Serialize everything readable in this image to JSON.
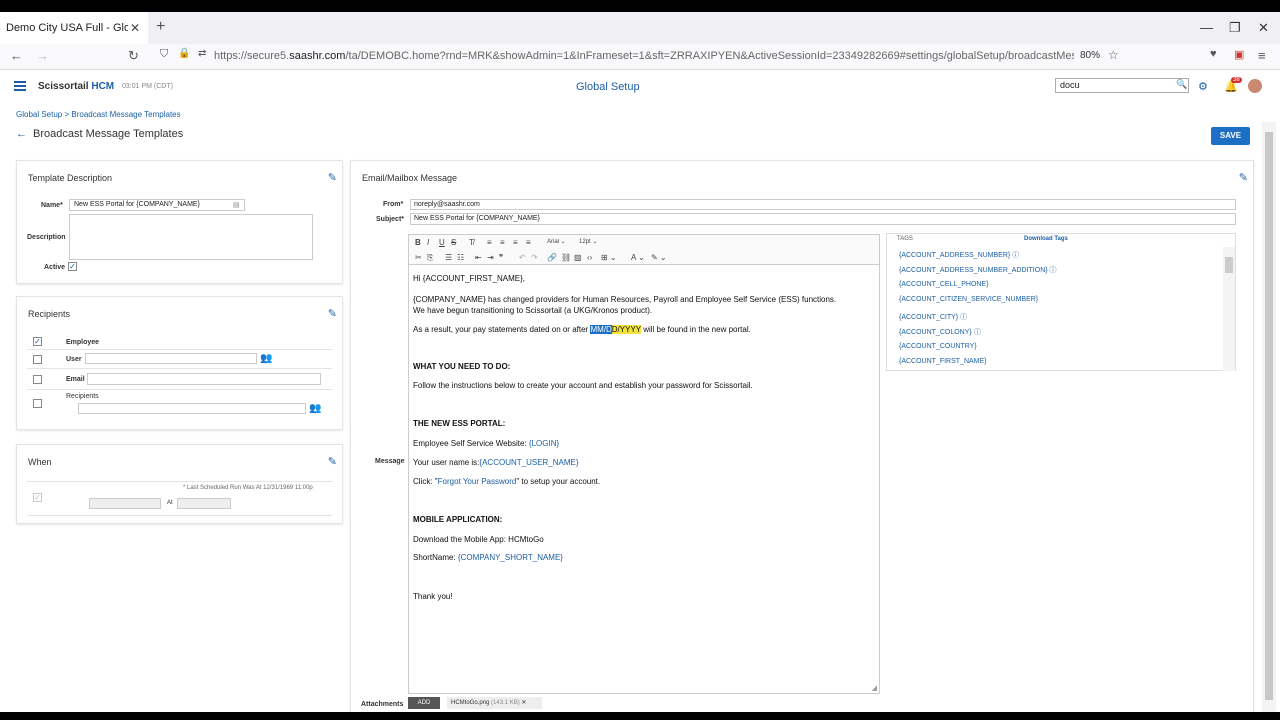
{
  "browser": {
    "tab_title": "Demo City USA Full - Global Setup",
    "tab_close": "✕",
    "new_tab": "+",
    "url_prefix": "https://secure5.",
    "url_domain": "saashr.com",
    "url_rest": "/ta/DEMOBC.home?rnd=MRK&showAdmin=1&InFrameset=1&sft=ZRRAXIPYEN&ActiveSessionId=23349282669#settings/globalSetup/broadcastMessageTemplates?impl=zeyt.progra",
    "zoom": "80%"
  },
  "header": {
    "logo_main": "Scissortail ",
    "logo_hcm": "HCM",
    "clock": "03:01 PM (CDT)",
    "title": "Global Setup",
    "search_value": "docu",
    "notif_count": "38"
  },
  "breadcrumb": "Global Setup > Broadcast Message Templates",
  "page_title": "Broadcast Message Templates",
  "save_label": "SAVE",
  "template": {
    "title": "Template Description",
    "name_label": "Name*",
    "name_value": "New ESS Portal for {COMPANY_NAME}",
    "description_label": "Description",
    "active_label": "Active"
  },
  "recipients": {
    "title": "Recipients",
    "employee": "Employee",
    "user": "User",
    "email": "Email",
    "recipients": "Recipients"
  },
  "when": {
    "title": "When",
    "last_run": "* Last Scheduled Run Was At 12/31/1969 11:00p",
    "at": "At"
  },
  "email": {
    "title": "Email/Mailbox Message",
    "from_label": "From*",
    "from_value": "noreply@saashr.com",
    "subject_label": "Subject*",
    "subject_value": "New ESS Portal for {COMPANY_NAME}",
    "message_label": "Message",
    "attachments_label": "Attachments",
    "add_label": "ADD",
    "attachment_file": "HCMtoGo.png",
    "attachment_size": "(143.1 KB)",
    "font": "Arial",
    "size": "12pt",
    "body": {
      "l1": "Hi {ACCOUNT_FIRST_NAME},",
      "l2": "{COMPANY_NAME} has changed providers for Human Resources, Payroll and Employee Self Service (ESS) functions.",
      "l3": "We have begun transitioning to Scissortail (a UKG/Kronos product).",
      "l4a": "As a result, your pay statements dated on or after ",
      "l4sel": "MM/D",
      "l4hl": "D/YYYY",
      "l4b": " will be found in the new portal.",
      "l5": "WHAT YOU NEED TO DO:",
      "l6": "Follow the instructions below to create your account and establish your password for Scissortail.",
      "l7": "THE NEW ESS PORTAL:",
      "l8a": "Employee Self Service Website: ",
      "l8b": "{LOGIN}",
      "l9a": "Your user name is:",
      "l9b": "{ACCOUNT_USER_NAME}",
      "l10a": "Click: \"",
      "l10b": "Forgot Your Password",
      "l10c": "\" to setup your account.",
      "l11": "MOBILE APPLICATION:",
      "l12": "Download the Mobile App: HCMtoGo",
      "l13a": "ShortName: ",
      "l13b": "{COMPANY_SHORT_NAME}",
      "l14": "Thank you!"
    }
  },
  "tags": {
    "title": "TAGS",
    "download": "Download Tags",
    "items": [
      "{ACCOUNT_ADDRESS_NUMBER}",
      "{ACCOUNT_ADDRESS_NUMBER_ADDITION}",
      "{ACCOUNT_CELL_PHONE}",
      "{ACCOUNT_CITIZEN_SERVICE_NUMBER}",
      "{ACCOUNT_CITY}",
      "{ACCOUNT_COLONY}",
      "{ACCOUNT_COUNTRY}",
      "{ACCOUNT_FIRST_NAME}"
    ]
  }
}
